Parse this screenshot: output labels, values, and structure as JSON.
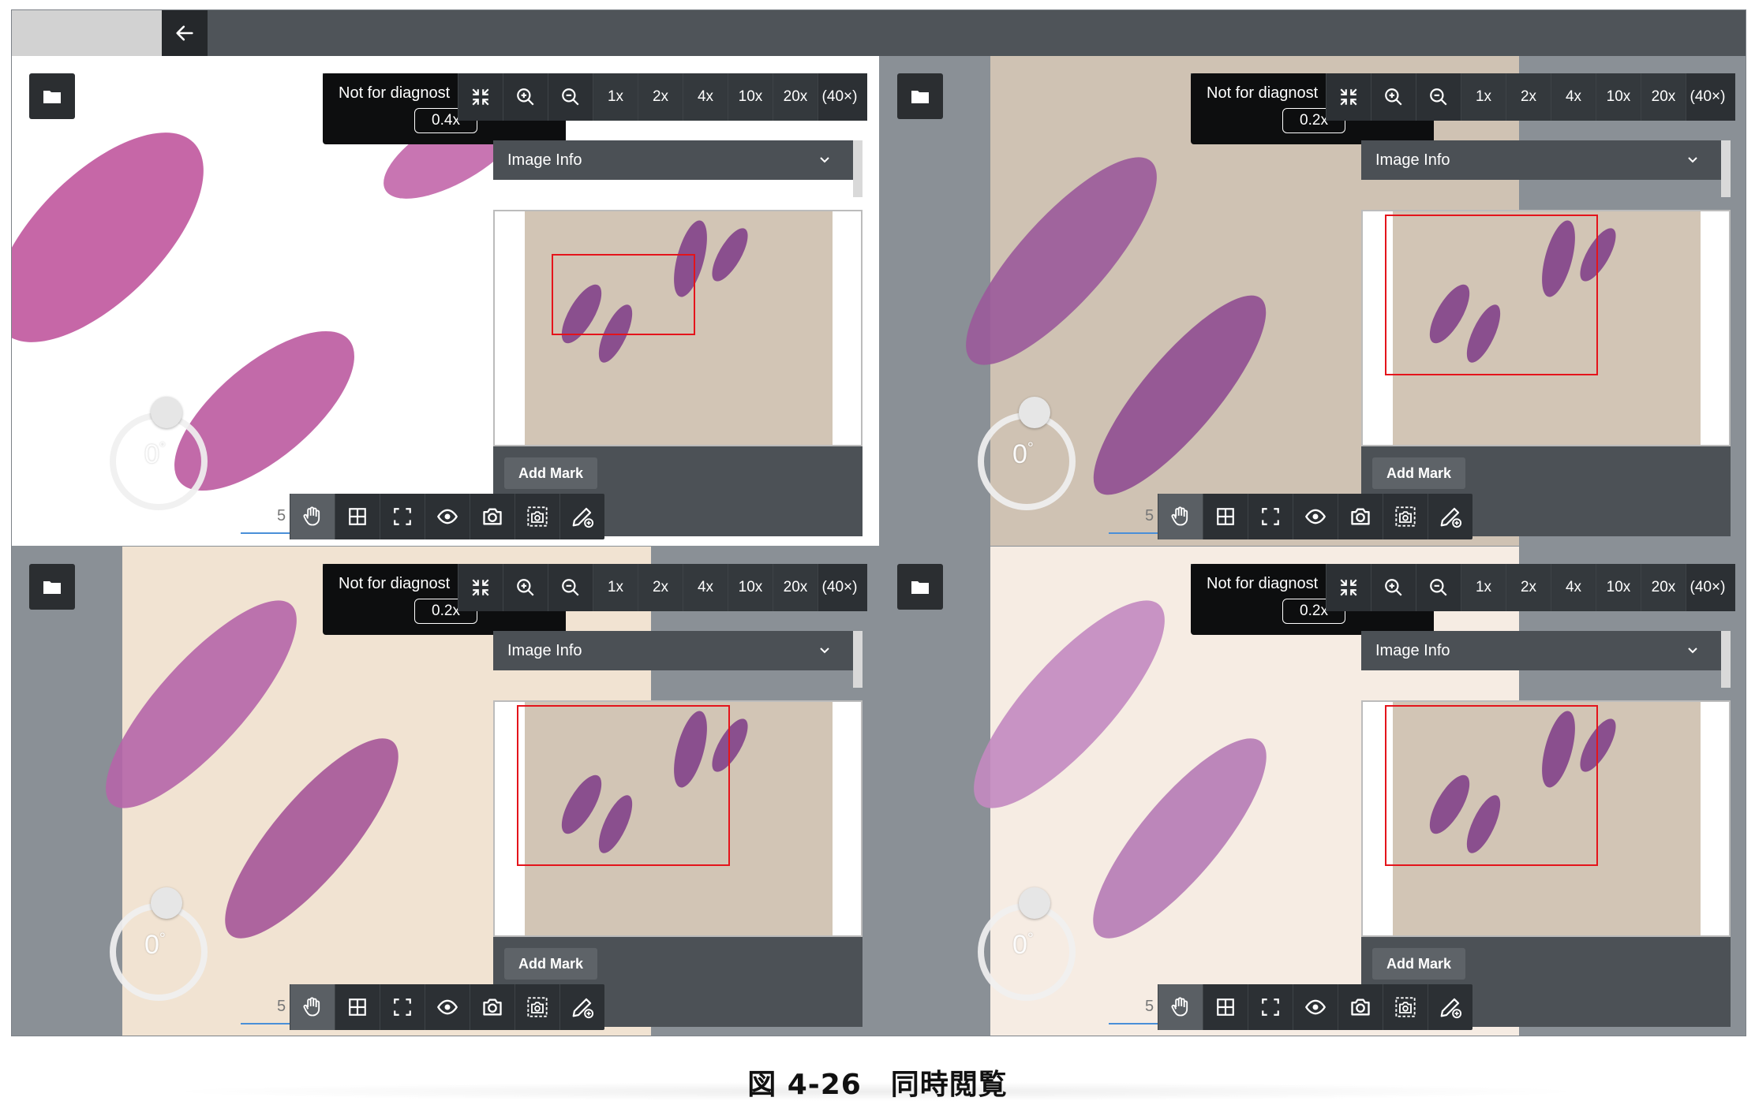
{
  "viewers": [
    {
      "zoom_label": "0.4x"
    },
    {
      "zoom_label": "0.2x"
    },
    {
      "zoom_label": "0.2x"
    },
    {
      "zoom_label": "0.2x"
    }
  ],
  "panel": {
    "not_for_diagnosis": "Not for diagnost",
    "zoom_buttons": [
      "1x",
      "2x",
      "4x",
      "10x",
      "20x",
      "(40×)"
    ],
    "image_info_label": "Image Info",
    "add_mark_label": "Add Mark",
    "rotation_value": "0",
    "rotation_unit": "°",
    "scale_fragment": "5"
  },
  "caption": "図 4-26　同時閲覧",
  "colors": {
    "roi": "#e4141b",
    "toolbar": "#2c3034",
    "topbar": "#4f5459",
    "tissue": "#9c5a9c"
  },
  "icons": {
    "back": "arrow-left-icon",
    "folder": "folder-icon",
    "zoom_tools": [
      "collapse-arrows-icon",
      "zoom-in-icon",
      "zoom-out-icon"
    ],
    "bottom_tools": [
      "hand-icon",
      "grid-icon",
      "fullscreen-icon",
      "eye-icon",
      "camera-icon",
      "region-camera-icon",
      "pen-mark-icon"
    ]
  }
}
